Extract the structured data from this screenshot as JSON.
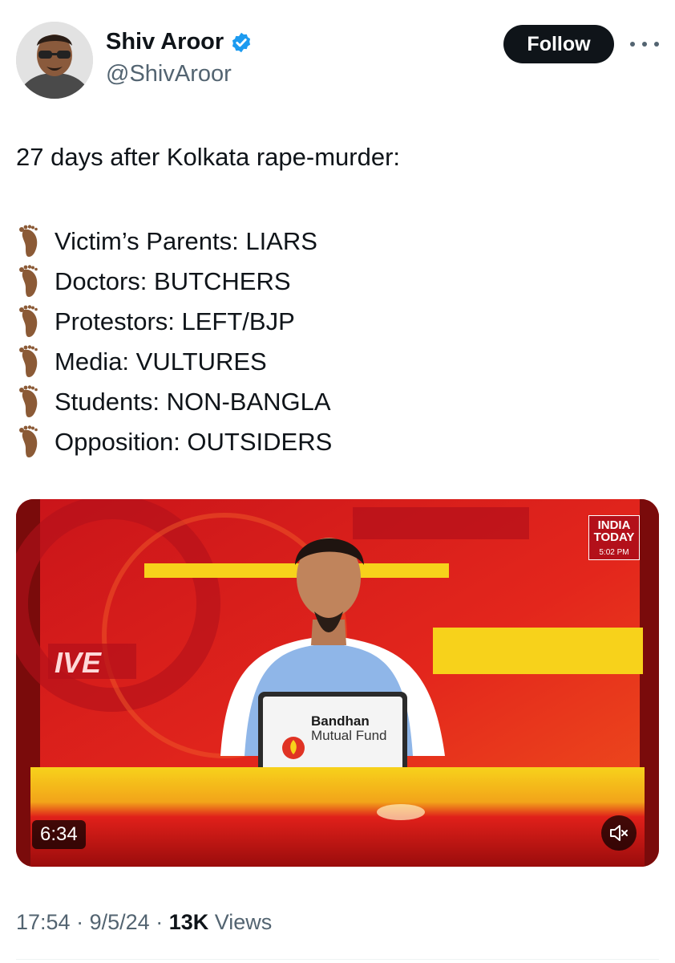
{
  "author": {
    "name": "Shiv Aroor",
    "handle": "@ShivAroor",
    "verified": true,
    "follow_label": "Follow"
  },
  "icons": {
    "verified": "verified-badge-icon",
    "more": "more-horizontal-icon",
    "bullet": "foot-emoji-icon",
    "mute": "speaker-muted-icon"
  },
  "tweet": {
    "intro": "27 days after Kolkata rape-murder:",
    "items": [
      "Victim’s Parents: LIARS",
      "Doctors: BUTCHERS",
      "Protestors: LEFT/BJP",
      "Media: VULTURES",
      "Students: NON-BANGLA",
      "Opposition: OUTSIDERS"
    ]
  },
  "video": {
    "duration": "6:34",
    "channel_logo_line1": "INDIA",
    "channel_logo_line2": "TODAY",
    "channel_time": "5:02 PM",
    "background_text": "IVE",
    "sponsor_line1": "Bandhan",
    "sponsor_line2": "Mutual Fund",
    "muted": true
  },
  "meta": {
    "time": "17:54",
    "date": "9/5/24",
    "views_count": "13K",
    "views_label": "Views",
    "separator": "·"
  },
  "colors": {
    "text": "#0f1419",
    "secondary": "#536471",
    "verified_blue": "#1d9bf0",
    "follow_bg": "#0f1419",
    "studio_red": "#d8201e",
    "studio_yellow": "#f7d21b"
  }
}
